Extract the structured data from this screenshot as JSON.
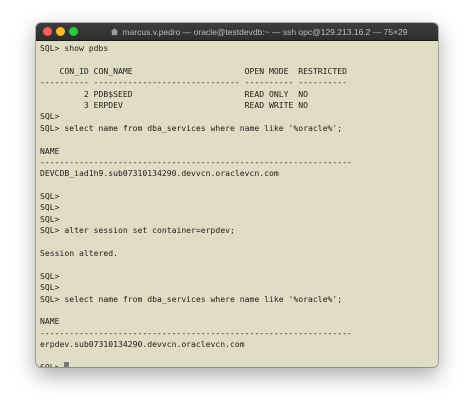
{
  "window": {
    "title": "marcus.v.pedro — oracle@testdevdb:~ — ssh opc@129.213.16.2 — 75×29",
    "home_icon": "home-folder-icon"
  },
  "terminal": {
    "lines": [
      "SQL> show pdbs",
      "",
      "    CON_ID CON_NAME                       OPEN MODE  RESTRICTED",
      "---------- ------------------------------ ---------- ----------",
      "         2 PDB$SEED                       READ ONLY  NO",
      "         3 ERPDEV                         READ WRITE NO",
      "SQL>",
      "SQL> select name from dba_services where name like '%oracle%';",
      "",
      "NAME",
      "----------------------------------------------------------------",
      "DEVCDB_iad1h9.sub07310134290.devvcn.oraclevcn.com",
      "",
      "SQL>",
      "SQL>",
      "SQL>",
      "SQL> alter session set container=erpdev;",
      "",
      "Session altered.",
      "",
      "SQL>",
      "SQL>",
      "SQL> select name from dba_services where name like '%oracle%';",
      "",
      "NAME",
      "----------------------------------------------------------------",
      "erpdev.sub07310134290.devvcn.oraclevcn.com",
      "",
      "SQL> "
    ]
  }
}
